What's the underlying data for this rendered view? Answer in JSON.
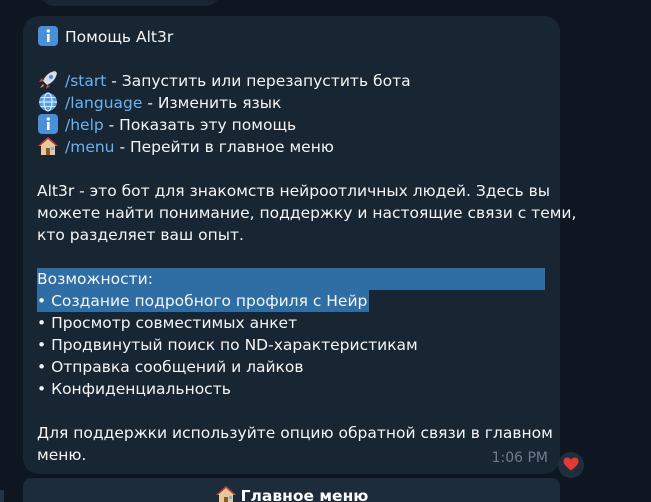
{
  "message": {
    "title": "Помощь Alt3r",
    "commands": [
      {
        "icon": "rocket-icon",
        "command": "/start",
        "description": " - Запустить или перезапустить бота"
      },
      {
        "icon": "globe-icon",
        "command": "/language",
        "description": " - Изменить язык"
      },
      {
        "icon": "info-icon",
        "command": "/help",
        "description": " - Показать эту помощь"
      },
      {
        "icon": "house-icon",
        "command": "/menu",
        "description": " - Перейти в главное меню"
      }
    ],
    "about": [
      "Alt3r - это бот для знакомств нейроотличных людей. Здесь вы",
      "можете найти понимание, поддержку и настоящие связи с теми,",
      "кто разделяет ваш опыт."
    ],
    "features_heading": "Возможности:",
    "features": [
      "• Создание подробного профиля с Нейр",
      "• Просмотр совместимых анкет",
      "• Продвинутый поиск по ND-характеристикам",
      "• Отправка сообщений и лайков",
      "• Конфиденциальность"
    ],
    "support": [
      "Для поддержки используйте опцию обратной связи в главном",
      "меню."
    ],
    "time": "1:06 PM"
  },
  "reaction": {
    "icon": "heart-icon"
  },
  "keyboard": {
    "button_icon": "house-icon",
    "button_label": "Главное меню"
  },
  "colors": {
    "background": "#0e1621",
    "bubble": "#182533",
    "command_link": "#6ab3f3",
    "selection": "#2f6ea5",
    "timestamp": "#6d7f8f"
  }
}
